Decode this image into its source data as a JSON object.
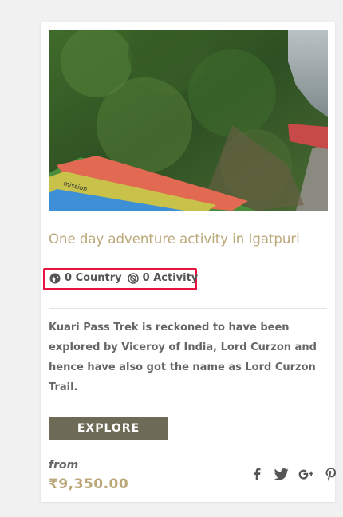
{
  "tour": {
    "title": "One day adventure activity in Igatpuri",
    "country_count": "0 Country",
    "activity_count": "0 Activity",
    "description": "Kuari Pass Trek is reckoned to have been explored by Viceroy of India, Lord Curzon and hence have also got the name as Lord Curzon Trail.",
    "explore_label": "EXPLORE",
    "from_label": "from",
    "price": "₹9,350.00"
  },
  "icons": {
    "country": "globe-icon",
    "activity": "activity-icon",
    "share": [
      "facebook-icon",
      "twitter-icon",
      "google-plus-icon",
      "pinterest-icon"
    ]
  },
  "colors": {
    "title": "#bba778",
    "price": "#bba778",
    "button": "#6d6a55",
    "highlight": "#e8143f"
  }
}
